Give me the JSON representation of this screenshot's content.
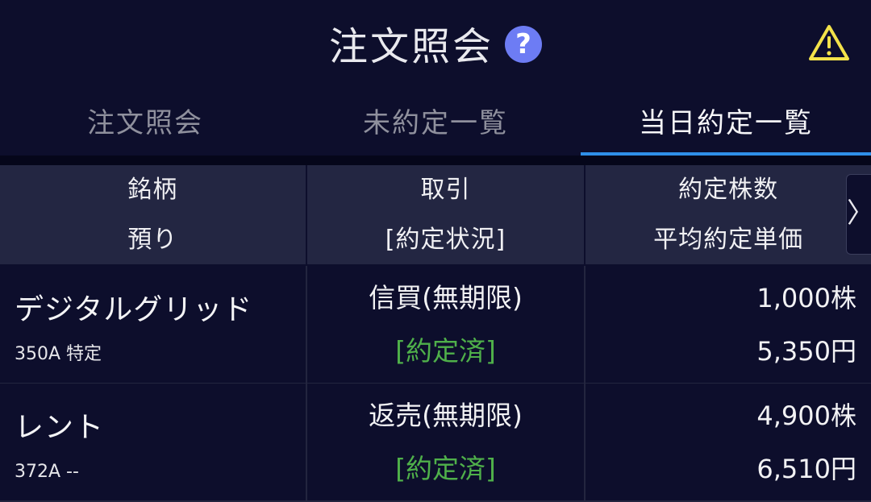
{
  "header": {
    "title": "注文照会",
    "help_icon": "question-circle-icon",
    "warning_icon": "warning-triangle-icon",
    "help_glyph": "?"
  },
  "tabs": [
    {
      "label": "注文照会",
      "active": false
    },
    {
      "label": "未約定一覧",
      "active": false
    },
    {
      "label": "当日約定一覧",
      "active": true
    }
  ],
  "table": {
    "columns": [
      {
        "line1": "銘柄",
        "line2": "預り"
      },
      {
        "line1": "取引",
        "line2": "[約定状況]"
      },
      {
        "line1": "約定株数",
        "line2": "平均約定単価"
      }
    ],
    "scroll_glyph": "〉",
    "rows": [
      {
        "name": "デジタルグリッド",
        "code": "350A 特定",
        "trade": "信買(無期限)",
        "status": "[約定済]",
        "shares": "1,000株",
        "price": "5,350円"
      },
      {
        "name": "レント",
        "code": "372A --",
        "trade": "返売(無期限)",
        "status": "[約定済]",
        "shares": "4,900株",
        "price": "6,510円"
      }
    ]
  },
  "colors": {
    "background": "#0d0e2c",
    "header_row": "#232642",
    "accent": "#2f8fe8",
    "status_green": "#4fb04a",
    "warning_yellow": "#f3e24a",
    "help_blue": "#6d7cf4"
  }
}
